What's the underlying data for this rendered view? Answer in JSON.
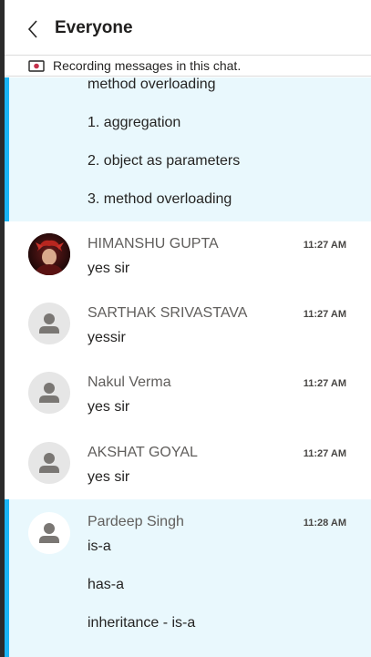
{
  "header": {
    "title": "Everyone"
  },
  "recording_bar": {
    "text": "Recording messages in this chat."
  },
  "messages": [
    {
      "lines": [
        "method overloading",
        "1. aggregation",
        "2. object as parameters",
        "3. method overloading"
      ]
    },
    {
      "sender": "HIMANSHU GUPTA",
      "time": "11:27 AM",
      "lines": [
        "yes sir"
      ],
      "avatar": "profile-photo"
    },
    {
      "sender": "SARTHAK SRIVASTAVA",
      "time": "11:27 AM",
      "lines": [
        "yessir"
      ],
      "avatar": "default-person"
    },
    {
      "sender": "Nakul Verma",
      "time": "11:27 AM",
      "lines": [
        "yes sir"
      ],
      "avatar": "default-person"
    },
    {
      "sender": "AKSHAT GOYAL",
      "time": "11:27 AM",
      "lines": [
        "yes sir"
      ],
      "avatar": "default-person"
    },
    {
      "sender": "Pardeep Singh",
      "time": "11:28 AM",
      "lines": [
        "is-a",
        "has-a",
        "inheritance - is-a"
      ],
      "avatar": "default-person"
    }
  ],
  "colors": {
    "highlight_bg": "#e9f8fd",
    "accent": "#19b4f5"
  }
}
